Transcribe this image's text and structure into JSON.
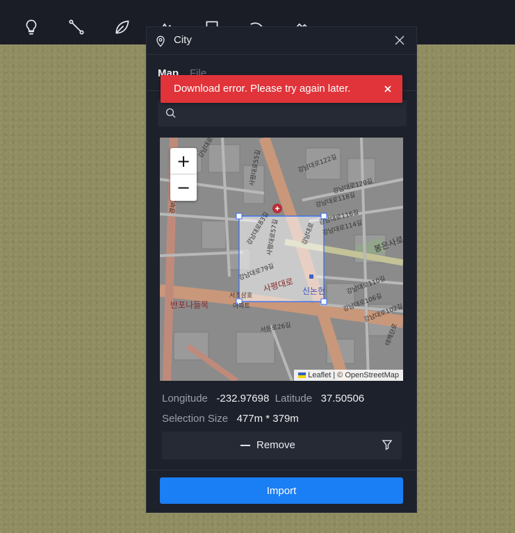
{
  "toolbar": {
    "tools": [
      "lightbulb-icon",
      "path-icon",
      "leaf-icon",
      "mountain-icon",
      "image-icon",
      "animal-icon",
      "terrain-icon"
    ]
  },
  "panel": {
    "title": "City",
    "tabs": [
      {
        "label": "Map",
        "active": true
      },
      {
        "label": "File",
        "active": false
      }
    ],
    "search": {
      "value": "",
      "placeholder": ""
    },
    "toast": {
      "message": "Download error. Please try again later."
    },
    "map": {
      "zoom_in": "+",
      "zoom_out": "−",
      "attribution_leaflet": "Leaflet",
      "attribution_osm": "| © OpenStreetMap",
      "labels": [
        "강남대로89길",
        "강남대로122길",
        "강남대로120길",
        "강남대로118길",
        "강남대로116길",
        "강남대로114길",
        "봉은사로",
        "강남대로110길",
        "강남대로106길",
        "강남대로102길",
        "강남대로79길",
        "강남대로83길",
        "서초삼호",
        "사평대로",
        "신논현",
        "반포나들목",
        "서운로26길",
        "경부고속도로",
        "아파트",
        "사평대로55길",
        "사평대로57길",
        "강남대로",
        "테헤란로"
      ]
    },
    "coords": {
      "longitude_label": "Longitude",
      "longitude_value": "-232.97698",
      "latitude_label": "Latitude",
      "latitude_value": "37.50506",
      "selection_label": "Selection Size",
      "selection_value": "477m * 379m"
    },
    "remove_label": "Remove",
    "import_label": "Import"
  },
  "colors": {
    "panel_bg": "#1d212b",
    "toast_bg": "#e0343a",
    "primary": "#1a7ef5"
  }
}
